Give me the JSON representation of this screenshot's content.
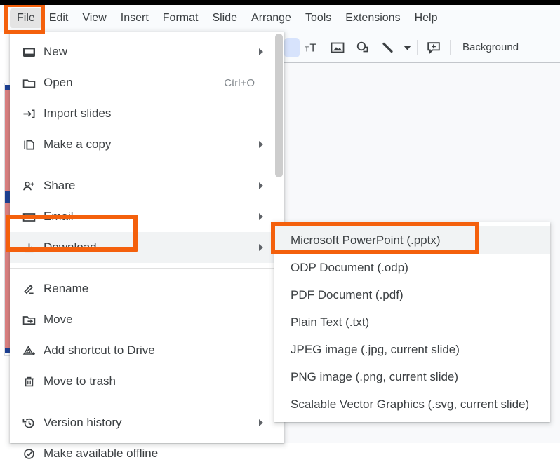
{
  "app": {
    "menubar": [
      {
        "label": "File",
        "active": true
      },
      {
        "label": "Edit",
        "active": false
      },
      {
        "label": "View",
        "active": false
      },
      {
        "label": "Insert",
        "active": false
      },
      {
        "label": "Format",
        "active": false
      },
      {
        "label": "Slide",
        "active": false
      },
      {
        "label": "Arrange",
        "active": false
      },
      {
        "label": "Tools",
        "active": false
      },
      {
        "label": "Extensions",
        "active": false
      },
      {
        "label": "Help",
        "active": false
      }
    ]
  },
  "toolbar": {
    "icons": [
      "text-box-icon",
      "insert-image-icon",
      "shape-icon",
      "line-icon",
      "line-dropdown-caret",
      "comment-icon"
    ],
    "background_label": "Background"
  },
  "file_menu": {
    "groups": [
      {
        "items": [
          {
            "label": "New",
            "icon": "new-presentation-icon",
            "accel": "",
            "arrow": true,
            "hovered": false
          },
          {
            "label": "Open",
            "icon": "folder-icon",
            "accel": "Ctrl+O",
            "arrow": false,
            "hovered": false
          },
          {
            "label": "Import slides",
            "icon": "import-slides-icon",
            "accel": "",
            "arrow": false,
            "hovered": false
          },
          {
            "label": "Make a copy",
            "icon": "copy-icon",
            "accel": "",
            "arrow": true,
            "hovered": false
          }
        ]
      },
      {
        "items": [
          {
            "label": "Share",
            "icon": "person-add-icon",
            "accel": "",
            "arrow": true,
            "hovered": false
          },
          {
            "label": "Email",
            "icon": "envelope-icon",
            "accel": "",
            "arrow": true,
            "hovered": false
          },
          {
            "label": "Download",
            "icon": "download-icon",
            "accel": "",
            "arrow": true,
            "hovered": true
          }
        ]
      },
      {
        "items": [
          {
            "label": "Rename",
            "icon": "pencil-icon",
            "accel": "",
            "arrow": false,
            "hovered": false
          },
          {
            "label": "Move",
            "icon": "move-folder-icon",
            "accel": "",
            "arrow": false,
            "hovered": false
          },
          {
            "label": "Add shortcut to Drive",
            "icon": "drive-shortcut-icon",
            "accel": "",
            "arrow": false,
            "hovered": false
          },
          {
            "label": "Move to trash",
            "icon": "trash-icon",
            "accel": "",
            "arrow": false,
            "hovered": false
          }
        ]
      },
      {
        "items": [
          {
            "label": "Version history",
            "icon": "history-icon",
            "accel": "",
            "arrow": true,
            "hovered": false
          },
          {
            "label": "Make available offline",
            "icon": "offline-check-icon",
            "accel": "",
            "arrow": false,
            "hovered": false
          }
        ]
      }
    ]
  },
  "download_submenu": {
    "items": [
      {
        "label": "Microsoft PowerPoint (.pptx)",
        "hovered": true
      },
      {
        "label": "ODP Document (.odp)",
        "hovered": false
      },
      {
        "label": "PDF Document (.pdf)",
        "hovered": false
      },
      {
        "label": "Plain Text (.txt)",
        "hovered": false
      },
      {
        "label": "JPEG image (.jpg, current slide)",
        "hovered": false
      },
      {
        "label": "PNG image (.png, current slide)",
        "hovered": false
      },
      {
        "label": "Scalable Vector Graphics (.svg, current slide)",
        "hovered": false
      }
    ]
  },
  "annotations": {
    "color": "#F4600C",
    "boxes": [
      "file-menu-highlight",
      "download-item-highlight",
      "powerpoint-option-highlight"
    ]
  }
}
